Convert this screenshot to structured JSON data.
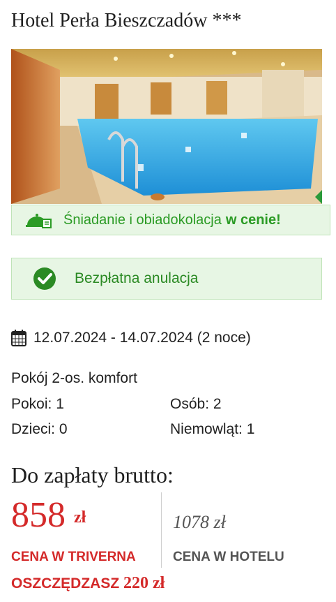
{
  "hotel": {
    "title": "Hotel Perła Bieszczadów ***"
  },
  "photo": {
    "subject": "indoor swimming pool"
  },
  "meal_banner": {
    "text": "Śniadanie i obiadokolacja",
    "emphasis": "w cenie!",
    "icon": "cloche-icon"
  },
  "cancel_banner": {
    "text": "Bezpłatna anulacja",
    "icon": "check-circle-icon"
  },
  "stay": {
    "dates": "12.07.2024 - 14.07.2024 (2 noce)",
    "icon": "calendar-icon"
  },
  "room": {
    "name": "Pokój 2-os. komfort",
    "rooms": "Pokoi: 1",
    "persons": "Osób: 2",
    "children": "Dzieci: 0",
    "infants": "Niemowląt: 1"
  },
  "pricing": {
    "title": "Do zapłaty brutto:",
    "main_price": "858",
    "currency": "zł",
    "main_label": "CENA W TRIVERNA",
    "hotel_price": "1078 zł",
    "hotel_label": "CENA W HOTELU",
    "savings_prefix": "OSZCZĘDZASZ",
    "savings_value": "220 zł"
  },
  "colors": {
    "accent_red": "#d42a2a",
    "green_text": "#2b9b25",
    "green_bg": "#e7f6e4"
  }
}
